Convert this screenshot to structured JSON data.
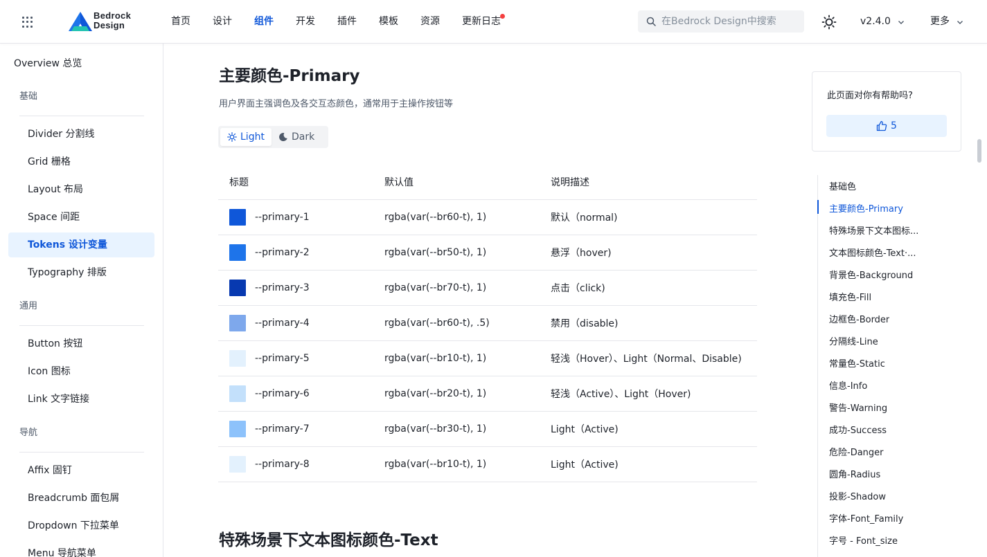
{
  "header": {
    "brand_line1": "Bedrock",
    "brand_line2": "Design",
    "nav": [
      "首页",
      "设计",
      "组件",
      "开发",
      "插件",
      "模板",
      "资源",
      "更新日志"
    ],
    "search_placeholder": "在Bedrock Design中搜索",
    "version": "v2.4.0",
    "more": "更多",
    "accent": "#0f57d9"
  },
  "sidebar": {
    "overview": "Overview 总览",
    "groups": {
      "basic": "基础",
      "common": "通用",
      "navigation": "导航"
    },
    "items": {
      "divider": "Divider 分割线",
      "grid": "Grid 栅格",
      "layout": "Layout 布局",
      "space": "Space 间距",
      "tokens": "Tokens 设计变量",
      "typography": "Typography 排版",
      "button": "Button 按钮",
      "icon": "Icon 图标",
      "link": "Link 文字链接",
      "affix": "Affix 固钉",
      "breadcrumb": "Breadcrumb 面包屑",
      "dropdown": "Dropdown 下拉菜单",
      "menu": "Menu 导航菜单"
    }
  },
  "main": {
    "title": "主要颜色-Primary",
    "description": "用户界面主强调色及各交互态颜色，通常用于主操作按钮等",
    "toggle": {
      "light": "Light",
      "dark": "Dark"
    },
    "columns": [
      "标题",
      "默认值",
      "说明描述"
    ],
    "rows": [
      {
        "name": "--primary-1",
        "value": "rgba(var(--br60-t), 1)",
        "desc": "默认（normal)",
        "color": "#0f57d9"
      },
      {
        "name": "--primary-2",
        "value": "rgba(var(--br50-t), 1)",
        "desc": "悬浮（hover)",
        "color": "#1e74ea"
      },
      {
        "name": "--primary-3",
        "value": "rgba(var(--br70-t), 1)",
        "desc": "点击（click)",
        "color": "#0739b0"
      },
      {
        "name": "--primary-4",
        "value": "rgba(var(--br60-t), .5)",
        "desc": "禁用（disable)",
        "color": "#7ea8ec"
      },
      {
        "name": "--primary-5",
        "value": "rgba(var(--br10-t), 1)",
        "desc": "轻浅（Hover）、Light（Normal、Disable)",
        "color": "#e3f1fd"
      },
      {
        "name": "--primary-6",
        "value": "rgba(var(--br20-t), 1)",
        "desc": "轻浅（Active）、Light（Hover)",
        "color": "#c3e0fb"
      },
      {
        "name": "--primary-7",
        "value": "rgba(var(--br30-t), 1)",
        "desc": "Light（Active)",
        "color": "#8dc2fb"
      },
      {
        "name": "--primary-8",
        "value": "rgba(var(--br10-t), 1)",
        "desc": "Light（Active)",
        "color": "#e3f1fd"
      }
    ],
    "next_title": "特殊场景下文本图标颜色-Text"
  },
  "helpful": {
    "question": "此页面对你有帮助吗?",
    "likes": "5"
  },
  "toc": [
    "基础色",
    "主要颜色-Primary",
    "特殊场景下文本图标...",
    "文本图标颜色-Text·...",
    "背景色-Background",
    "填充色-Fill",
    "边框色-Border",
    "分隔线-Line",
    "常量色-Static",
    "信息-Info",
    "警告-Warning",
    "成功-Success",
    "危险-Danger",
    "圆角-Radius",
    "投影-Shadow",
    "字体-Font_Family",
    "字号 - Font_size"
  ]
}
